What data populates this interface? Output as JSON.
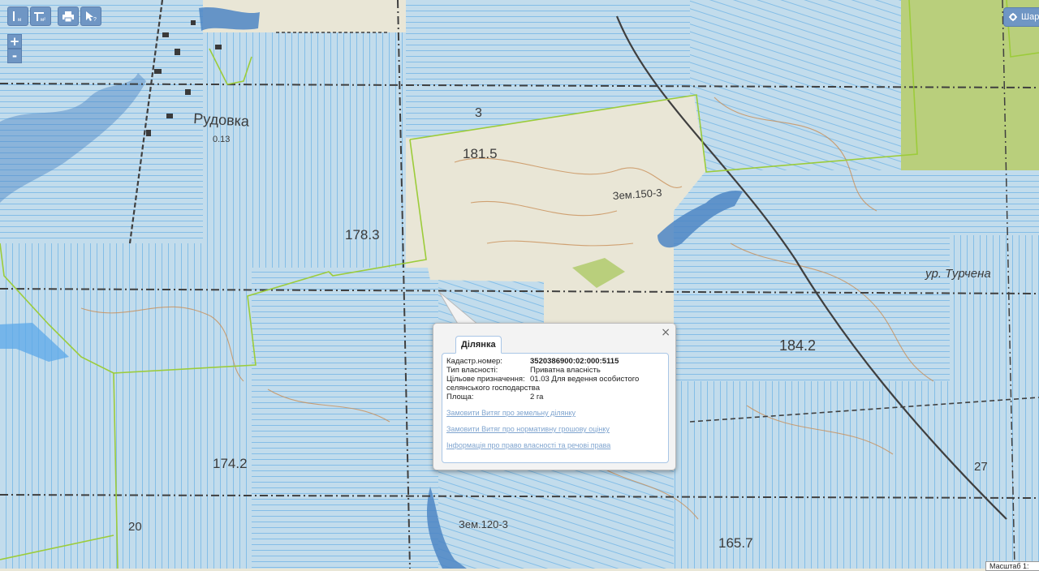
{
  "toolbar": {
    "measure_length_icon": "measure-length-icon",
    "measure_area_icon": "measure-area-icon",
    "print_icon": "print-icon",
    "identify_icon": "identify-icon",
    "zoom_in_label": "+",
    "zoom_out_label": "-",
    "layers_label": "Шари"
  },
  "map": {
    "labels": [
      "Рудовка",
      "181.5",
      "178.3",
      "Зем.150-3",
      "184.2",
      "174.2",
      "165.7",
      "Зем.120-3",
      "ур. Турчена",
      "3",
      "20",
      "27",
      "0.13"
    ],
    "colors": {
      "parcel_fill": "#c2dcec",
      "parcel_stroke": "#74b6e6",
      "boundary": "#9ccc3a",
      "forest": "#b9cf7c",
      "water": "#4d86c4",
      "base": "#e9e6d6"
    }
  },
  "popup": {
    "tab_label": "Ділянка",
    "close_label": "×",
    "fields": [
      {
        "label": "Кадастр.номер:",
        "value": "3520386900:02:000:5115",
        "strong": true
      },
      {
        "label": "Тип власності:",
        "value": "Приватна власність",
        "strong": false
      },
      {
        "label": "Цільове призначення:",
        "value": "01.03 Для ведення особистого",
        "strong": false
      }
    ],
    "purpose_continuation": "селянського господарства",
    "area_label": "Площа:",
    "area_value": "2 га",
    "links": [
      "Замовити Витяг про земельну ділянку",
      "Замовити Витяг про нормативну грошову оцінку",
      "Інформація про право власності та речові права"
    ]
  },
  "scale": {
    "label": "Масштаб 1:"
  }
}
